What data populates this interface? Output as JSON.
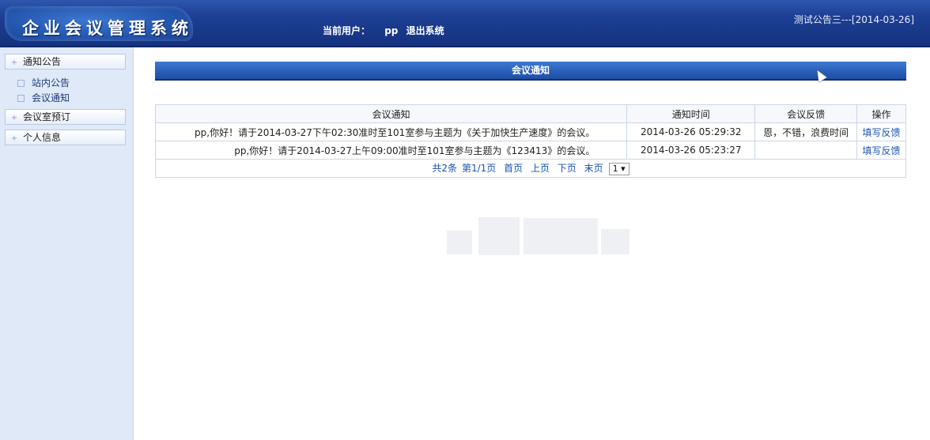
{
  "header": {
    "logo_text": "企业会议管理系统",
    "user_label": "当前用户：",
    "username": "pp",
    "logout": "退出系统",
    "ticker": "测试公告三---[2014-03-26]"
  },
  "sidebar": {
    "menus": [
      {
        "label": "通知公告",
        "sub": [
          "站内公告",
          "会议通知"
        ]
      },
      {
        "label": "会议室预订",
        "sub": []
      },
      {
        "label": "个人信息",
        "sub": []
      }
    ]
  },
  "content": {
    "title": "会议通知",
    "columns": [
      "会议通知",
      "通知时间",
      "会议反馈",
      "操作"
    ],
    "rows": [
      {
        "message": "pp,你好！请于2014-03-27下午02:30准时至101室参与主题为《关于加快生产速度》的会议。",
        "time": "2014-03-26 05:29:32",
        "feedback": "恩，不错，浪费时间",
        "action": "填写反馈"
      },
      {
        "message": "pp,你好！请于2014-03-27上午09:00准时至101室参与主题为《123413》的会议。",
        "time": "2014-03-26 05:23:27",
        "feedback": "",
        "action": "填写反馈"
      }
    ],
    "pager": {
      "total": "共2条",
      "page_info": "第1/1页",
      "first": "首页",
      "prev": "上页",
      "next": "下页",
      "last": "末页",
      "page_select": "1 ▾"
    }
  }
}
